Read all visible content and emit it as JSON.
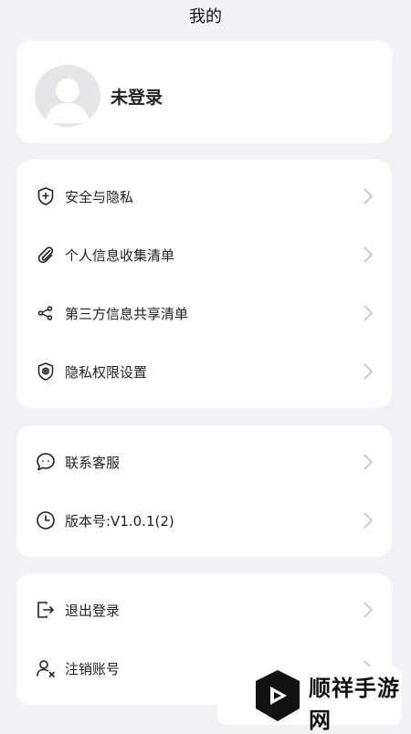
{
  "header": {
    "title": "我的"
  },
  "profile": {
    "name": "未登录",
    "avatar_icon": "avatar-placeholder-icon"
  },
  "group1": [
    {
      "label": "安全与隐私",
      "icon": "shield-plus-icon"
    },
    {
      "label": "个人信息收集清单",
      "icon": "paperclip-icon"
    },
    {
      "label": "第三方信息共享清单",
      "icon": "share-icon"
    },
    {
      "label": "隐私权限设置",
      "icon": "privacy-settings-icon"
    }
  ],
  "group2": [
    {
      "label": "联系客服",
      "icon": "chat-bubble-icon"
    },
    {
      "label": "版本号:V1.0.1(2)",
      "icon": "clock-icon"
    }
  ],
  "group3": [
    {
      "label": "退出登录",
      "icon": "logout-icon"
    },
    {
      "label": "注销账号",
      "icon": "user-remove-icon"
    }
  ],
  "watermark": {
    "title": "顺祥手游网",
    "sub_accent": "",
    "sub": ""
  },
  "colors": {
    "background": "#f2f2f4",
    "card": "#ffffff",
    "text": "#222222",
    "chevron": "#c4c4c4"
  }
}
